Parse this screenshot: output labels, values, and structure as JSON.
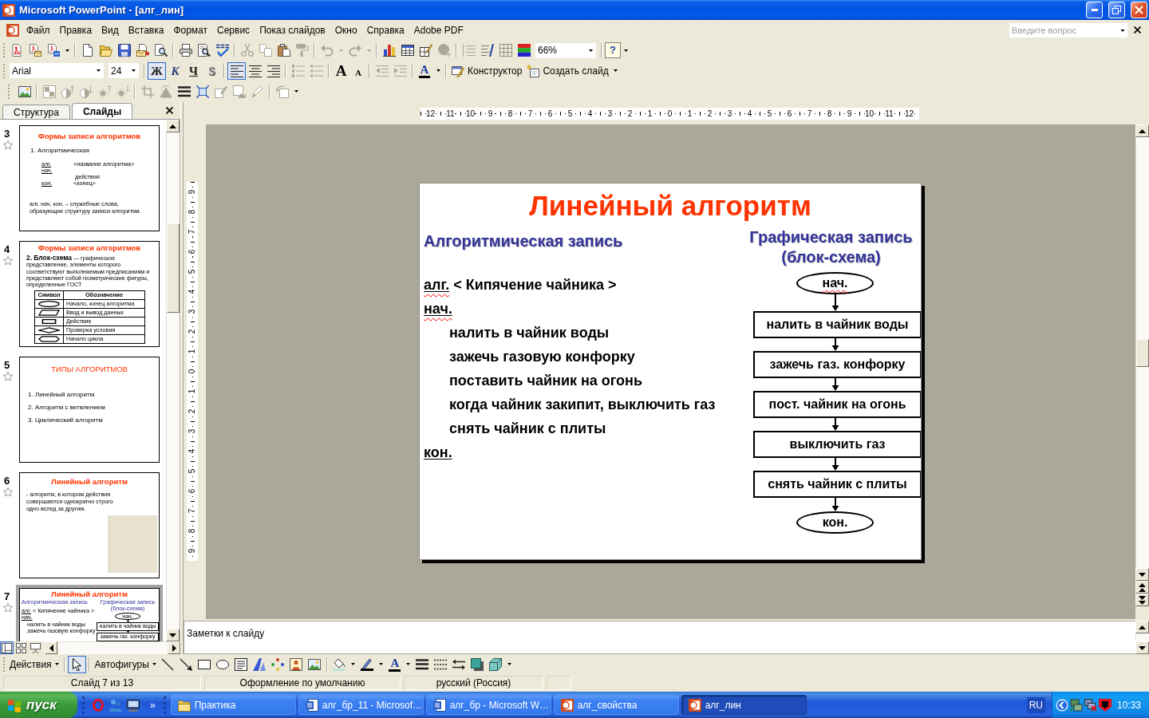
{
  "window": {
    "title": "Microsoft PowerPoint - [алг_лин]"
  },
  "menu": {
    "items": [
      "Файл",
      "Правка",
      "Вид",
      "Вставка",
      "Формат",
      "Сервис",
      "Показ слайдов",
      "Окно",
      "Справка",
      "Adobe PDF"
    ],
    "help_field": {
      "placeholder": "Введите вопрос"
    }
  },
  "standard_toolbar": [
    [
      {
        "kind": "pdf",
        "disabled": false
      },
      {
        "kind": "pdfmail",
        "disabled": false
      },
      {
        "kind": "pdfreview",
        "disabled": false
      },
      {
        "kind": "caret",
        "disabled": false
      }
    ],
    [
      {
        "kind": "new",
        "disabled": false
      },
      {
        "kind": "open",
        "disabled": false
      },
      {
        "kind": "save",
        "disabled": false
      },
      {
        "kind": "mail",
        "disabled": false
      },
      {
        "kind": "search",
        "disabled": false
      }
    ],
    [
      {
        "kind": "print",
        "disabled": false
      },
      {
        "kind": "preview",
        "disabled": false
      },
      {
        "kind": "spelling",
        "disabled": false
      }
    ],
    [
      {
        "kind": "cut",
        "disabled": true
      },
      {
        "kind": "copy",
        "disabled": true
      },
      {
        "kind": "paste",
        "disabled": false
      },
      {
        "kind": "painter",
        "disabled": true
      }
    ],
    [
      {
        "kind": "undo",
        "disabled": true
      },
      {
        "kind": "caret",
        "disabled": true
      },
      {
        "kind": "redo",
        "disabled": true
      },
      {
        "kind": "caret",
        "disabled": true
      }
    ],
    [
      {
        "kind": "chart",
        "disabled": false
      },
      {
        "kind": "table",
        "disabled": false
      },
      {
        "kind": "drawtable",
        "disabled": false
      },
      {
        "kind": "hyperlink",
        "disabled": true
      }
    ],
    [
      {
        "kind": "expand",
        "disabled": true
      },
      {
        "kind": "formatting",
        "disabled": false
      },
      {
        "kind": "grid",
        "disabled": false
      },
      {
        "kind": "grayscale",
        "disabled": false
      },
      {
        "kind": "zoom",
        "value": "66%"
      }
    ],
    [
      {
        "kind": "help",
        "label": "?"
      },
      {
        "kind": "caret",
        "disabled": false
      }
    ]
  ],
  "formatting_toolbar": [
    [
      {
        "kind": "font",
        "value": "Arial"
      },
      {
        "kind": "size",
        "value": "24"
      }
    ],
    [
      {
        "kind": "bold",
        "label": "Ж",
        "selected": true
      },
      {
        "kind": "italic",
        "label": "К",
        "selected": false
      },
      {
        "kind": "underline",
        "label": "Ч",
        "selected": false
      },
      {
        "kind": "shadow",
        "label": "S",
        "selected": false
      }
    ],
    [
      {
        "kind": "alignleft",
        "selected": true
      },
      {
        "kind": "aligncenter",
        "selected": false
      },
      {
        "kind": "alignright",
        "selected": false
      }
    ],
    [
      {
        "kind": "numbering",
        "disabled": true
      },
      {
        "kind": "bullets",
        "disabled": true
      }
    ],
    [
      {
        "kind": "grow",
        "label": "A"
      },
      {
        "kind": "shrink",
        "label": "A"
      }
    ],
    [
      {
        "kind": "outdent",
        "disabled": true
      },
      {
        "kind": "indent",
        "disabled": true
      }
    ],
    [
      {
        "kind": "fontcolor",
        "label": "A"
      },
      {
        "kind": "caret",
        "disabled": false
      }
    ],
    [
      {
        "kind": "design",
        "label": "Конструктор"
      },
      {
        "kind": "newslide",
        "label": "Создать слайд"
      },
      {
        "kind": "caret",
        "disabled": false
      }
    ]
  ],
  "picture_toolbar": [
    [
      {
        "kind": "insertpicture",
        "disabled": false
      }
    ],
    [
      {
        "kind": "colorpic",
        "disabled": true
      },
      {
        "kind": "morecontrast",
        "disabled": true
      },
      {
        "kind": "lesscontrast",
        "disabled": true
      },
      {
        "kind": "morebright",
        "disabled": true
      },
      {
        "kind": "lessbright",
        "disabled": true
      }
    ],
    [
      {
        "kind": "crop",
        "disabled": true
      },
      {
        "kind": "rotate",
        "disabled": true
      },
      {
        "kind": "linestyle",
        "disabled": false
      },
      {
        "kind": "compress",
        "disabled": false
      },
      {
        "kind": "recolor",
        "disabled": true
      },
      {
        "kind": "formatpicture",
        "disabled": true
      },
      {
        "kind": "transparent",
        "disabled": true
      }
    ],
    [
      {
        "kind": "reset",
        "disabled": true
      },
      {
        "kind": "caret",
        "disabled": false
      }
    ]
  ],
  "rulers": {
    "horizontal": [
      "12",
      "11",
      "10",
      "9",
      "8",
      "7",
      "6",
      "5",
      "4",
      "3",
      "2",
      "1",
      "0",
      "1",
      "2",
      "3",
      "4",
      "5",
      "6",
      "7",
      "8",
      "9",
      "10",
      "11",
      "12"
    ],
    "vertical": [
      "9",
      "8",
      "7",
      "6",
      "5",
      "4",
      "3",
      "2",
      "1",
      "0",
      "1",
      "2",
      "3",
      "4",
      "5",
      "6",
      "7",
      "8",
      "9"
    ]
  },
  "slides_pane": {
    "tabs": [
      {
        "label": "Структура",
        "selected": false
      },
      {
        "label": "Слайды",
        "selected": true
      }
    ],
    "slides": [
      {
        "number": "3",
        "selected": false,
        "animated": true,
        "kind": "outline",
        "title": "Формы записи алгоритмов",
        "subtitle": "1. Алгоритмическая",
        "algorithm": [
          {
            "kind": "declaration",
            "keyword": "алг.",
            "text": "<название алгоритма>"
          },
          {
            "kind": "keyword",
            "keyword": "нач."
          },
          {
            "kind": "step",
            "text": "действия"
          },
          {
            "kind": "declaration",
            "keyword": "кон.",
            "text": "<конец>"
          }
        ],
        "note": "алг, нач, кон, – служебные слова, образующие структуру записи алгоритма"
      },
      {
        "number": "4",
        "selected": false,
        "animated": true,
        "kind": "table",
        "title": "Формы записи алгоритмов",
        "text": "**2. Блок-схема** — графическое представление, элементы которого соответствуют выполняемым предписаниям и представляют собой геометрические фигуры, определенные ГОСТ",
        "columns": [
          "Символ",
          "Обозначение"
        ],
        "rows": [
          {
            "kind": "oval",
            "label": "Начало, конец алгоритма"
          },
          {
            "kind": "parallelogram",
            "label": "Ввод и вывод данных"
          },
          {
            "kind": "rectangle",
            "label": "Действие"
          },
          {
            "kind": "diamond",
            "label": "Проверка условия"
          },
          {
            "kind": "hexagon",
            "label": "Начало цикла"
          }
        ]
      },
      {
        "number": "5",
        "selected": false,
        "animated": true,
        "kind": "list",
        "title": "ТИПЫ АЛГОРИТМОВ",
        "items": [
          "1. Линейный алгоритм",
          "2. Алгоритм с ветвлением",
          "3. Циклический алгоритм"
        ]
      },
      {
        "number": "6",
        "selected": false,
        "animated": true,
        "kind": "picture",
        "title": "Линейный алгоритм",
        "text": "- алгоритм, в котором действия совершаются однократно строго одно вслед за другим."
      },
      {
        "number": "7",
        "selected": true,
        "animated": true,
        "kind": "flowchart",
        "title": "Линейный алгоритм",
        "left_header": "Алгоритмическая запись",
        "right_header": "Графическая запись (блок-схема)",
        "algorithm": [
          {
            "kind": "declaration",
            "keyword": "алг.",
            "text": "< Кипячение чайника >"
          },
          {
            "kind": "keyword",
            "keyword": "нач."
          },
          {
            "kind": "step",
            "text": "налить в чайник воды"
          },
          {
            "kind": "step",
            "text": "зажечь газовую конфорку"
          }
        ],
        "flowchart": [
          {
            "kind": "terminal",
            "text": "нач."
          },
          {
            "kind": "process",
            "text": "налить в чайник воды"
          },
          {
            "kind": "process",
            "text": "зажечь газ. конфорку"
          }
        ]
      }
    ],
    "view_buttons": [
      {
        "kind": "normal",
        "selected": true
      },
      {
        "kind": "sorter",
        "selected": false
      },
      {
        "kind": "show",
        "selected": false
      }
    ]
  },
  "slide": {
    "kind": "flowchart",
    "title": "Линейный алгоритм",
    "left_header": "Алгоритмическая запись",
    "right_header": "Графическая запись (блок-схема)",
    "algorithm": [
      {
        "kind": "declaration",
        "keyword": "алг.",
        "text": "< Кипячение чайника >",
        "misspelled": true
      },
      {
        "kind": "keyword",
        "keyword": "нач.",
        "misspelled": true
      },
      {
        "kind": "step",
        "text": "налить в чайник воды"
      },
      {
        "kind": "step",
        "text": "зажечь газовую конфорку"
      },
      {
        "kind": "step",
        "text": "поставить чайник на огонь"
      },
      {
        "kind": "step",
        "text": "когда чайник закипит, выключить газ"
      },
      {
        "kind": "step",
        "text": "снять чайник с плиты"
      },
      {
        "kind": "keyword",
        "keyword": "кон.",
        "misspelled": false
      }
    ],
    "flowchart": [
      {
        "kind": "terminal",
        "text": "нач.",
        "misspelled": true
      },
      {
        "kind": "process",
        "text": "налить в чайник воды"
      },
      {
        "kind": "process",
        "text": "зажечь газ. конфорку"
      },
      {
        "kind": "process",
        "text": "пост. чайник на огонь"
      },
      {
        "kind": "process",
        "text": "выключить газ"
      },
      {
        "kind": "process",
        "text": "снять чайник с плиты"
      },
      {
        "kind": "terminal",
        "text": "кон.",
        "misspelled": false
      }
    ]
  },
  "notes": {
    "placeholder": "Заметки к слайду"
  },
  "drawing_toolbar": [
    [
      {
        "kind": "menu",
        "label": "Действия"
      }
    ],
    [
      {
        "kind": "pointer",
        "selected": true
      }
    ],
    [
      {
        "kind": "menu",
        "label": "Автофигуры"
      },
      {
        "kind": "line"
      },
      {
        "kind": "arrow"
      },
      {
        "kind": "rect"
      },
      {
        "kind": "oval"
      },
      {
        "kind": "textbox"
      },
      {
        "kind": "wordart"
      },
      {
        "kind": "diagram"
      },
      {
        "kind": "clipart"
      },
      {
        "kind": "insertpicture"
      }
    ],
    [
      {
        "kind": "fill"
      },
      {
        "kind": "caret"
      },
      {
        "kind": "linecolor"
      },
      {
        "kind": "caret"
      },
      {
        "kind": "fontcolor",
        "label": "A"
      },
      {
        "kind": "caret"
      },
      {
        "kind": "linestyle"
      },
      {
        "kind": "dashstyle"
      },
      {
        "kind": "arrowstyle"
      },
      {
        "kind": "shadow3"
      },
      {
        "kind": "threed"
      },
      {
        "kind": "caret"
      }
    ]
  ],
  "status_bar": [
    "Слайд 7 из 13",
    "Оформление по умолчанию",
    "русский (Россия)"
  ],
  "taskbar": {
    "start": "пуск",
    "quick_launch": [
      {
        "kind": "opera"
      },
      {
        "kind": "app"
      },
      {
        "kind": "desktop"
      }
    ],
    "more": "»",
    "tasks": [
      {
        "kind": "folder",
        "label": "Практика",
        "selected": false
      },
      {
        "kind": "word",
        "label": "алг_бр_11 - Microsof…",
        "selected": false
      },
      {
        "kind": "word",
        "label": "алг_бр - Microsoft W…",
        "selected": false
      },
      {
        "kind": "powerpoint",
        "label": "алг_свойства",
        "selected": false
      },
      {
        "kind": "powerpoint",
        "label": "алг_лин",
        "selected": true
      }
    ],
    "language": "RU",
    "tray": [
      {
        "kind": "back"
      },
      {
        "kind": "network"
      },
      {
        "kind": "networkoff"
      },
      {
        "kind": "shield"
      }
    ],
    "clock": "10:33"
  }
}
